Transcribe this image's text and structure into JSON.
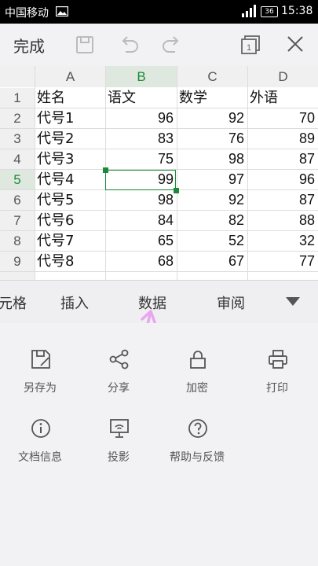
{
  "status_bar": {
    "carrier": "中国移动",
    "battery": "36",
    "time": "15:38"
  },
  "toolbar": {
    "done_label": "完成"
  },
  "sheet": {
    "columns": [
      "A",
      "B",
      "C",
      "D"
    ],
    "selected_column": "B",
    "selected_row": "5",
    "rows": [
      {
        "num": "1",
        "cells": [
          "姓名",
          "语文",
          "数学",
          "外语"
        ]
      },
      {
        "num": "2",
        "cells": [
          "代号1",
          "96",
          "92",
          "70"
        ]
      },
      {
        "num": "3",
        "cells": [
          "代号2",
          "83",
          "76",
          "89"
        ]
      },
      {
        "num": "4",
        "cells": [
          "代号3",
          "75",
          "98",
          "87"
        ]
      },
      {
        "num": "5",
        "cells": [
          "代号4",
          "99",
          "97",
          "96"
        ]
      },
      {
        "num": "6",
        "cells": [
          "代号5",
          "98",
          "92",
          "87"
        ]
      },
      {
        "num": "7",
        "cells": [
          "代号6",
          "84",
          "82",
          "88"
        ]
      },
      {
        "num": "8",
        "cells": [
          "代号7",
          "65",
          "52",
          "32"
        ]
      },
      {
        "num": "9",
        "cells": [
          "代号8",
          "68",
          "67",
          "77"
        ]
      }
    ]
  },
  "tabs": [
    "元格",
    "插入",
    "数据",
    "审阅"
  ],
  "tools": [
    {
      "label": "另存为",
      "icon": "save-as-icon"
    },
    {
      "label": "分享",
      "icon": "share-icon"
    },
    {
      "label": "加密",
      "icon": "lock-icon"
    },
    {
      "label": "打印",
      "icon": "print-icon"
    },
    {
      "label": "文档信息",
      "icon": "info-icon"
    },
    {
      "label": "投影",
      "icon": "projection-icon"
    },
    {
      "label": "帮助与反馈",
      "icon": "help-icon"
    }
  ],
  "colors": {
    "accent": "#1a8a3a",
    "annotation_arrow": "#e9a6f0"
  }
}
